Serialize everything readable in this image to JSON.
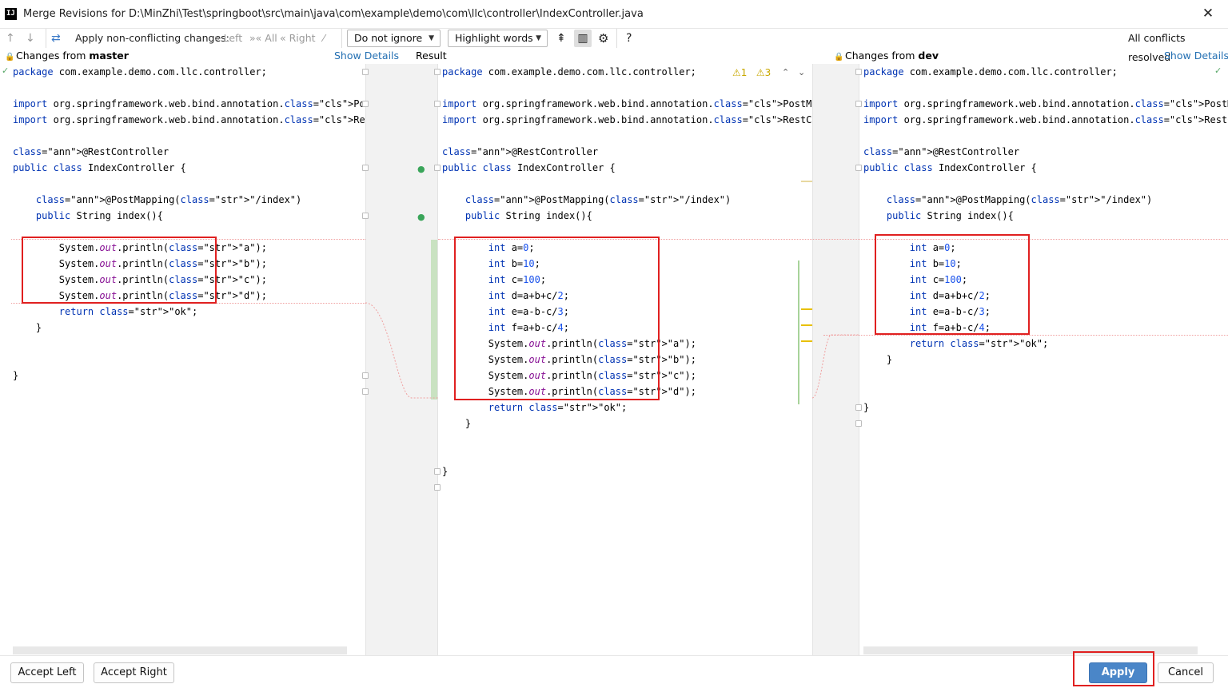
{
  "window": {
    "title": "Merge Revisions for D:\\MinZhi\\Test\\springboot\\src\\main\\java\\com\\example\\demo\\com\\llc\\controller\\IndexController.java",
    "close_glyph": "✕"
  },
  "toolbar": {
    "up_glyph": "↑",
    "down_glyph": "↓",
    "magic_glyph": "⇄",
    "apply_label": "Apply non-conflicting changes:",
    "left_label": "Left",
    "all_label": "All",
    "right_label": "Right",
    "wand_glyph": "⁄",
    "ignore_select": "Do not ignore",
    "highlight_select": "Highlight words",
    "collapse_glyph": "⇞",
    "columns_glyph": "▥",
    "gear_glyph": "⚙",
    "help_glyph": "?",
    "status": "All conflicts resolved"
  },
  "panes": {
    "left": {
      "header_prefix": "Changes from ",
      "header_branch": "master",
      "show_details": "Show Details"
    },
    "center": {
      "header": "Result",
      "warn1": "⚠1",
      "warn2": "⚠3"
    },
    "right": {
      "header_prefix": "Changes from ",
      "header_branch": "dev",
      "show_details": "Show Details"
    }
  },
  "code": {
    "left": [
      "package com.example.demo.com.llc.controller;",
      "",
      "import org.springframework.web.bind.annotation.PostMapping;",
      "import org.springframework.web.bind.annotation.RestController;",
      "",
      "@RestController",
      "public class IndexController {",
      "",
      "    @PostMapping(\"/index\")",
      "    public String index(){",
      "",
      "        System.out.println(\"a\");",
      "        System.out.println(\"b\");",
      "        System.out.println(\"c\");",
      "        System.out.println(\"d\");",
      "        return \"ok\";",
      "    }",
      "",
      "",
      "}"
    ],
    "center": [
      "package com.example.demo.com.llc.controller;",
      "",
      "import org.springframework.web.bind.annotation.PostMapping;",
      "import org.springframework.web.bind.annotation.RestController;",
      "",
      "@RestController",
      "public class IndexController {",
      "",
      "    @PostMapping(\"/index\")",
      "    public String index(){",
      "",
      "        int a=0;",
      "        int b=10;",
      "        int c=100;",
      "        int d=a+b+c/2;",
      "        int e=a-b-c/3;",
      "        int f=a+b-c/4;",
      "        System.out.println(\"a\");",
      "        System.out.println(\"b\");",
      "        System.out.println(\"c\");",
      "        System.out.println(\"d\");",
      "        return \"ok\";",
      "    }",
      "",
      "",
      "}"
    ],
    "right": [
      "package com.example.demo.com.llc.controller;",
      "",
      "import org.springframework.web.bind.annotation.PostMapping;",
      "import org.springframework.web.bind.annotation.RestController;",
      "",
      "@RestController",
      "public class IndexController {",
      "",
      "    @PostMapping(\"/index\")",
      "    public String index(){",
      "",
      "        int a=0;",
      "        int b=10;",
      "        int c=100;",
      "        int d=a+b+c/2;",
      "        int e=a-b-c/3;",
      "        int f=a+b-c/4;",
      "        return \"ok\";",
      "    }",
      "",
      "",
      "}"
    ]
  },
  "buttons": {
    "accept_left": "Accept Left",
    "accept_right": "Accept Right",
    "apply": "Apply",
    "cancel": "Cancel"
  },
  "colors": {
    "keyword": "#0033b3",
    "string": "#067d17",
    "annotation": "#9e880d",
    "italic_field": "#871094",
    "number": "#1750eb",
    "class_ref": "#d4850a",
    "highlight_box": "#e02020",
    "apply_button": "#4a86c8"
  }
}
